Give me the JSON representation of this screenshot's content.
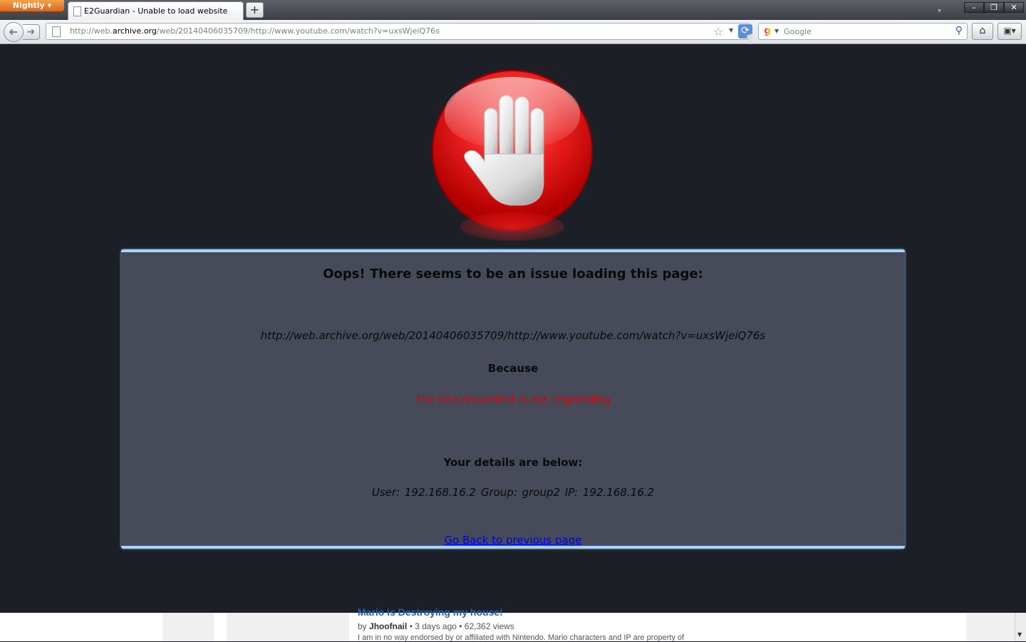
{
  "browser": {
    "app_button": "Nightly",
    "tab_title": "E2Guardian - Unable to load website",
    "new_tab_label": "+",
    "url_prefix": "http://web.",
    "url_host": "archive.org",
    "url_rest": "/web/20140406035709/http://www.youtube.com/watch?v=uxsWjeiQ76s",
    "search_placeholder": "Google",
    "window_buttons": {
      "minimize": "–",
      "restore": "❐",
      "close": "✕"
    }
  },
  "block_page": {
    "heading": "Oops! There seems to be an issue loading this page:",
    "blocked_url": "http://web.archive.org/web/20140406035709/http://www.youtube.com/watch?v=uxsWjeiQ76s",
    "because_label": "Because",
    "reason": "The site requested is not responding",
    "details_heading": "Your details are below:",
    "user_info": "User: 192.168.16.2   Group: group2   IP: 192.168.16.2",
    "back_link": "Go Back to previous page"
  },
  "underlying_page": {
    "video_title": "Mario is Destroying my house!",
    "meta_by": "by ",
    "meta_author": "Jhoofnail",
    "meta_rest": " • 3 days ago • 62,362 views",
    "description": "I am in no way endorsed by or affiliated with Nintendo. Mario characters and IP are property of"
  },
  "colors": {
    "accent_border": "#a9d3ff",
    "reason_text": "#e00000",
    "panel_bg": "#464a59",
    "page_bg": "#1c1f26"
  }
}
